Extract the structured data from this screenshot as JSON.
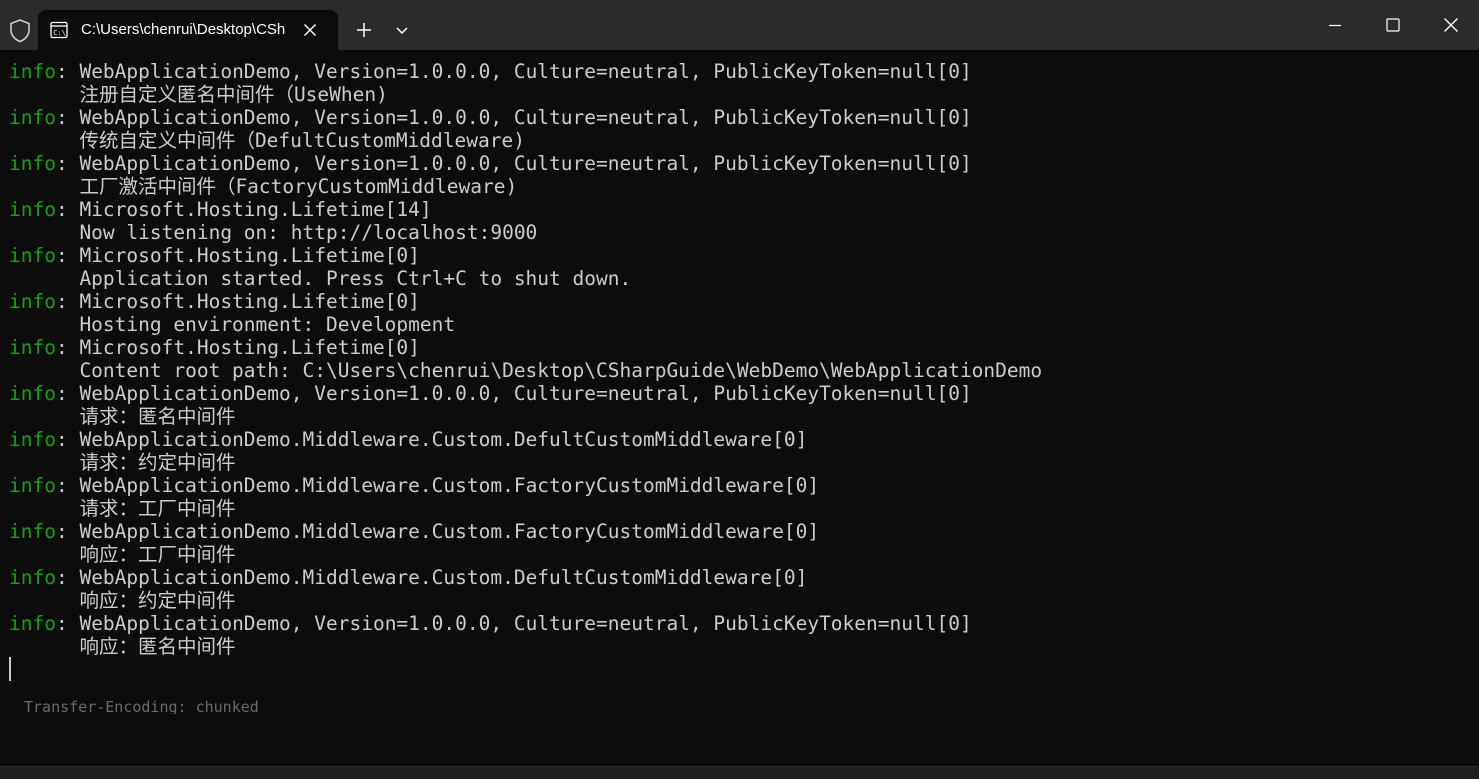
{
  "titlebar": {
    "tab_title": "C:\\Users\\chenrui\\Desktop\\CSharpGuide\\WebDemo\\WebApplicationDemo\\bin\\Debug\\net8.0\\WebApplicationDemo.exe",
    "icons": {
      "shield": "shield-icon",
      "terminal": "terminal-icon",
      "close_tab": "close-icon",
      "new_tab": "plus-icon",
      "dropdown": "chevron-down-icon",
      "minimize": "minimize-icon",
      "maximize": "maximize-icon",
      "close_window": "close-icon"
    }
  },
  "colors": {
    "titlebar_bg": "#2b2b2b",
    "terminal_bg": "#0c0c0c",
    "text": "#cccccc",
    "level_green": "#13a10e"
  },
  "terminal": {
    "lines": [
      {
        "level": "info",
        "text": ": WebApplicationDemo, Version=1.0.0.0, Culture=neutral, PublicKeyToken=null[0]"
      },
      {
        "level": "",
        "text": "      注册自定义匿名中间件（UseWhen)"
      },
      {
        "level": "info",
        "text": ": WebApplicationDemo, Version=1.0.0.0, Culture=neutral, PublicKeyToken=null[0]"
      },
      {
        "level": "",
        "text": "      传统自定义中间件（DefultCustomMiddleware)"
      },
      {
        "level": "info",
        "text": ": WebApplicationDemo, Version=1.0.0.0, Culture=neutral, PublicKeyToken=null[0]"
      },
      {
        "level": "",
        "text": "      工厂激活中间件（FactoryCustomMiddleware)"
      },
      {
        "level": "info",
        "text": ": Microsoft.Hosting.Lifetime[14]"
      },
      {
        "level": "",
        "text": "      Now listening on: http://localhost:9000"
      },
      {
        "level": "info",
        "text": ": Microsoft.Hosting.Lifetime[0]"
      },
      {
        "level": "",
        "text": "      Application started. Press Ctrl+C to shut down."
      },
      {
        "level": "info",
        "text": ": Microsoft.Hosting.Lifetime[0]"
      },
      {
        "level": "",
        "text": "      Hosting environment: Development"
      },
      {
        "level": "info",
        "text": ": Microsoft.Hosting.Lifetime[0]"
      },
      {
        "level": "",
        "text": "      Content root path: C:\\Users\\chenrui\\Desktop\\CSharpGuide\\WebDemo\\WebApplicationDemo"
      },
      {
        "level": "info",
        "text": ": WebApplicationDemo, Version=1.0.0.0, Culture=neutral, PublicKeyToken=null[0]"
      },
      {
        "level": "",
        "text": "      请求：匿名中间件"
      },
      {
        "level": "info",
        "text": ": WebApplicationDemo.Middleware.Custom.DefultCustomMiddleware[0]"
      },
      {
        "level": "",
        "text": "      请求：约定中间件"
      },
      {
        "level": "info",
        "text": ": WebApplicationDemo.Middleware.Custom.FactoryCustomMiddleware[0]"
      },
      {
        "level": "",
        "text": "      请求：工厂中间件"
      },
      {
        "level": "info",
        "text": ": WebApplicationDemo.Middleware.Custom.FactoryCustomMiddleware[0]"
      },
      {
        "level": "",
        "text": "      响应：工厂中间件"
      },
      {
        "level": "info",
        "text": ": WebApplicationDemo.Middleware.Custom.DefultCustomMiddleware[0]"
      },
      {
        "level": "",
        "text": "      响应：约定中间件"
      },
      {
        "level": "info",
        "text": ": WebApplicationDemo, Version=1.0.0.0, Culture=neutral, PublicKeyToken=null[0]"
      },
      {
        "level": "",
        "text": "      响应：匿名中间件"
      }
    ],
    "stray_text": "Transfer-Encoding: chunked"
  }
}
